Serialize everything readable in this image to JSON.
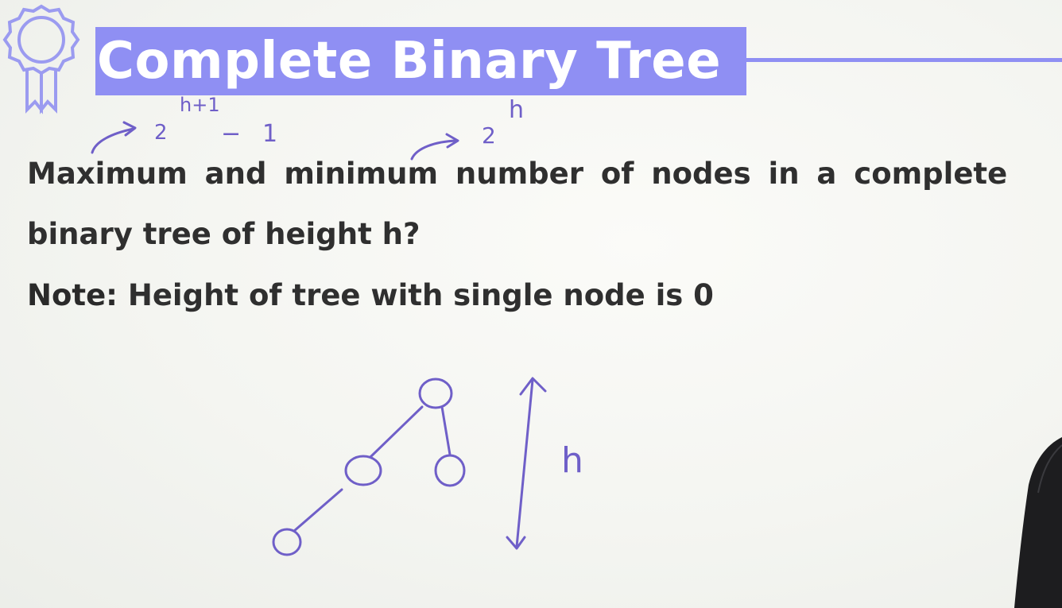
{
  "slide": {
    "title": "Complete Binary Tree",
    "question_line1": "Maximum and minimum number of nodes in a complete",
    "question_line2": "binary tree of height h?",
    "note_label": "Note:",
    "note_text": " Height of tree with single node is 0",
    "accent_color": "#8f8ff3",
    "badge_icon": "award-ribbon-icon"
  },
  "annotations": {
    "max_base": "2",
    "max_exponent": "h+1",
    "max_minus": "−",
    "max_one": "1",
    "min_base": "2",
    "min_exponent": "h",
    "height_label": "h",
    "ink_color": "#6f5fc8"
  }
}
